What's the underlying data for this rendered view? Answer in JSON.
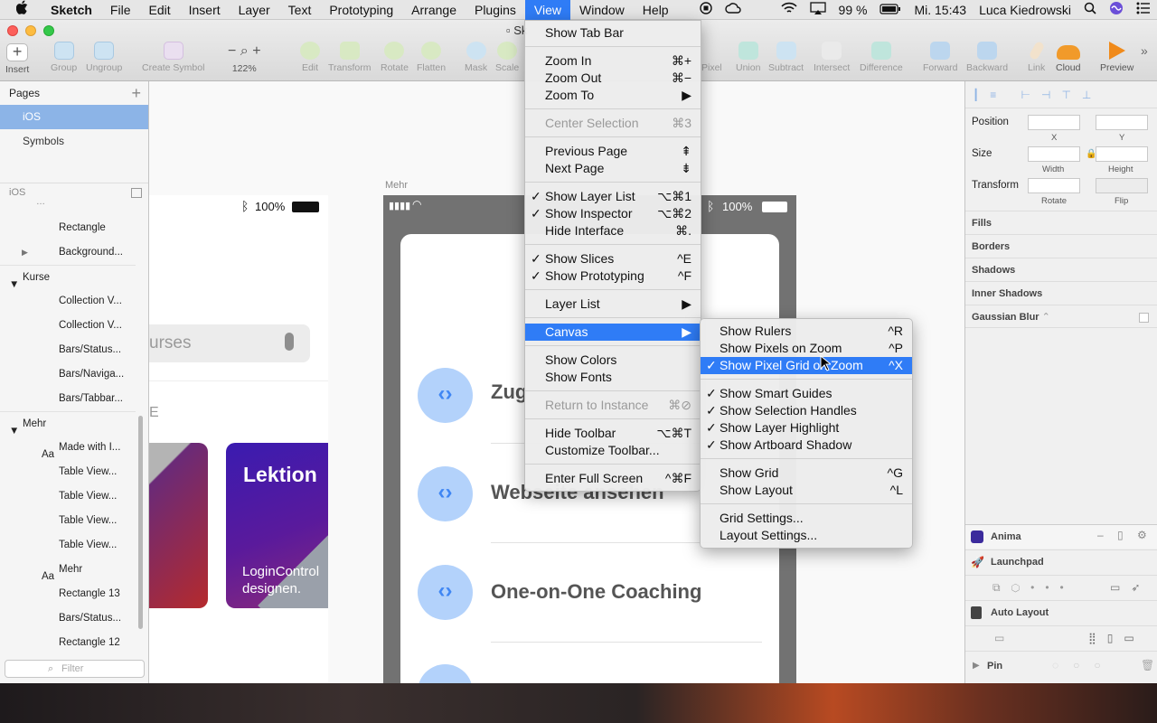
{
  "menubar": {
    "apple": "",
    "app": "Sketch",
    "items": [
      "File",
      "Edit",
      "Insert",
      "Layer",
      "Text",
      "Prototyping",
      "Arrange",
      "Plugins",
      "View",
      "Window",
      "Help"
    ],
    "active": "View",
    "battery": "99 %",
    "clock": "Mi. 15:43",
    "user": "Luca Kiedrowski"
  },
  "window": {
    "doc_title": "Sk"
  },
  "toolbar": {
    "items": [
      "Insert",
      "Group",
      "Ungroup",
      "Create Symbol",
      "122%",
      "Edit",
      "Transform",
      "Rotate",
      "Flatten",
      "Mask",
      "Scale",
      "Pixel",
      "Union",
      "Subtract",
      "Intersect",
      "Difference",
      "Forward",
      "Backward",
      "Link",
      "Cloud",
      "Preview"
    ],
    "zoom": "122%"
  },
  "pages": {
    "header": "Pages",
    "items": [
      "iOS",
      "Symbols"
    ],
    "selected": "iOS"
  },
  "layers": {
    "page": "iOS",
    "rows": [
      {
        "label": "Rectangle",
        "type": "rect"
      },
      {
        "label": "Background...",
        "type": "folder"
      },
      {
        "label": "Kurse",
        "type": "group"
      },
      {
        "label": "Collection V...",
        "type": "symbol"
      },
      {
        "label": "Collection V...",
        "type": "symbol"
      },
      {
        "label": "Bars/Status...",
        "type": "symbol"
      },
      {
        "label": "Bars/Naviga...",
        "type": "symbol"
      },
      {
        "label": "Bars/Tabbar...",
        "type": "symbol"
      },
      {
        "label": "Mehr",
        "type": "group"
      },
      {
        "label": "Made with I...",
        "type": "text"
      },
      {
        "label": "Table View...",
        "type": "symbol"
      },
      {
        "label": "Table View...",
        "type": "symbol"
      },
      {
        "label": "Table View...",
        "type": "symbol"
      },
      {
        "label": "Table View...",
        "type": "symbol"
      },
      {
        "label": "Mehr",
        "type": "text"
      },
      {
        "label": "Rectangle 13",
        "type": "rect"
      },
      {
        "label": "Bars/Status...",
        "type": "symbol"
      },
      {
        "label": "Rectangle 12",
        "type": "rect"
      }
    ],
    "filter_placeholder": "Filter"
  },
  "canvas": {
    "left_artboard": {
      "battery": "100%",
      "search": "urses",
      "section": "E",
      "card_title": "Lektion",
      "card_sub1": "LoginControl",
      "card_sub2": "designen."
    },
    "right_artboard": {
      "name": "Mehr",
      "battery": "100%",
      "rows": [
        "Zug",
        "Webseite ansehen",
        "One-on-One Coaching"
      ]
    }
  },
  "inspector": {
    "position": "Position",
    "size": "Size",
    "transform": "Transform",
    "x": "X",
    "y": "Y",
    "width": "Width",
    "height": "Height",
    "rotate": "Rotate",
    "flip": "Flip",
    "sections": [
      "Fills",
      "Borders",
      "Shadows",
      "Inner Shadows",
      "Gaussian Blur"
    ],
    "plugins": [
      "Anima",
      "Launchpad",
      "Auto Layout",
      "Pin"
    ]
  },
  "view_menu": [
    {
      "label": "Show Tab Bar",
      "shortcut": "",
      "checked": false,
      "disabled": false
    },
    {
      "sep": true
    },
    {
      "label": "Zoom In",
      "shortcut": "⌘+",
      "checked": false,
      "disabled": false
    },
    {
      "label": "Zoom Out",
      "shortcut": "⌘−",
      "checked": false,
      "disabled": false
    },
    {
      "label": "Zoom To",
      "shortcut": "▶",
      "checked": false,
      "disabled": false
    },
    {
      "sep": true
    },
    {
      "label": "Center Selection",
      "shortcut": "⌘3",
      "checked": false,
      "disabled": true
    },
    {
      "sep": true
    },
    {
      "label": "Previous Page",
      "shortcut": "⇞",
      "checked": false,
      "disabled": false
    },
    {
      "label": "Next Page",
      "shortcut": "⇟",
      "checked": false,
      "disabled": false
    },
    {
      "sep": true
    },
    {
      "label": "Show Layer List",
      "shortcut": "⌥⌘1",
      "checked": true,
      "disabled": false
    },
    {
      "label": "Show Inspector",
      "shortcut": "⌥⌘2",
      "checked": true,
      "disabled": false
    },
    {
      "label": "Hide Interface",
      "shortcut": "⌘.",
      "checked": false,
      "disabled": false
    },
    {
      "sep": true
    },
    {
      "label": "Show Slices",
      "shortcut": "^E",
      "checked": true,
      "disabled": false
    },
    {
      "label": "Show Prototyping",
      "shortcut": "^F",
      "checked": true,
      "disabled": false
    },
    {
      "sep": true
    },
    {
      "label": "Layer List",
      "shortcut": "▶",
      "checked": false,
      "disabled": false
    },
    {
      "sep": true
    },
    {
      "label": "Canvas",
      "shortcut": "▶",
      "checked": false,
      "disabled": false,
      "highlighted": true
    },
    {
      "sep": true
    },
    {
      "label": "Show Colors",
      "shortcut": "",
      "checked": false,
      "disabled": false
    },
    {
      "label": "Show Fonts",
      "shortcut": "",
      "checked": false,
      "disabled": false
    },
    {
      "sep": true
    },
    {
      "label": "Return to Instance",
      "shortcut": "⌘⊘",
      "checked": false,
      "disabled": true
    },
    {
      "sep": true
    },
    {
      "label": "Hide Toolbar",
      "shortcut": "⌥⌘T",
      "checked": false,
      "disabled": false
    },
    {
      "label": "Customize Toolbar...",
      "shortcut": "",
      "checked": false,
      "disabled": false
    },
    {
      "sep": true
    },
    {
      "label": "Enter Full Screen",
      "shortcut": "^⌘F",
      "checked": false,
      "disabled": false
    }
  ],
  "canvas_menu": [
    {
      "label": "Show Rulers",
      "shortcut": "^R",
      "checked": false
    },
    {
      "label": "Show Pixels on Zoom",
      "shortcut": "^P",
      "checked": false
    },
    {
      "label": "Show Pixel Grid on Zoom",
      "shortcut": "^X",
      "checked": true,
      "highlighted": true
    },
    {
      "sep": true
    },
    {
      "label": "Show Smart Guides",
      "shortcut": "",
      "checked": true
    },
    {
      "label": "Show Selection Handles",
      "shortcut": "",
      "checked": true
    },
    {
      "label": "Show Layer Highlight",
      "shortcut": "",
      "checked": true
    },
    {
      "label": "Show Artboard Shadow",
      "shortcut": "",
      "checked": true
    },
    {
      "sep": true
    },
    {
      "label": "Show Grid",
      "shortcut": "^G",
      "checked": false
    },
    {
      "label": "Show Layout",
      "shortcut": "^L",
      "checked": false
    },
    {
      "sep": true
    },
    {
      "label": "Grid Settings...",
      "shortcut": "",
      "checked": false
    },
    {
      "label": "Layout Settings...",
      "shortcut": "",
      "checked": false
    }
  ],
  "colors": {
    "accent": "#2f7cf6",
    "selection": "#8cb4e7",
    "code_icon_bg": "#b3d2fb",
    "code_icon_fg": "#3f86f3"
  }
}
